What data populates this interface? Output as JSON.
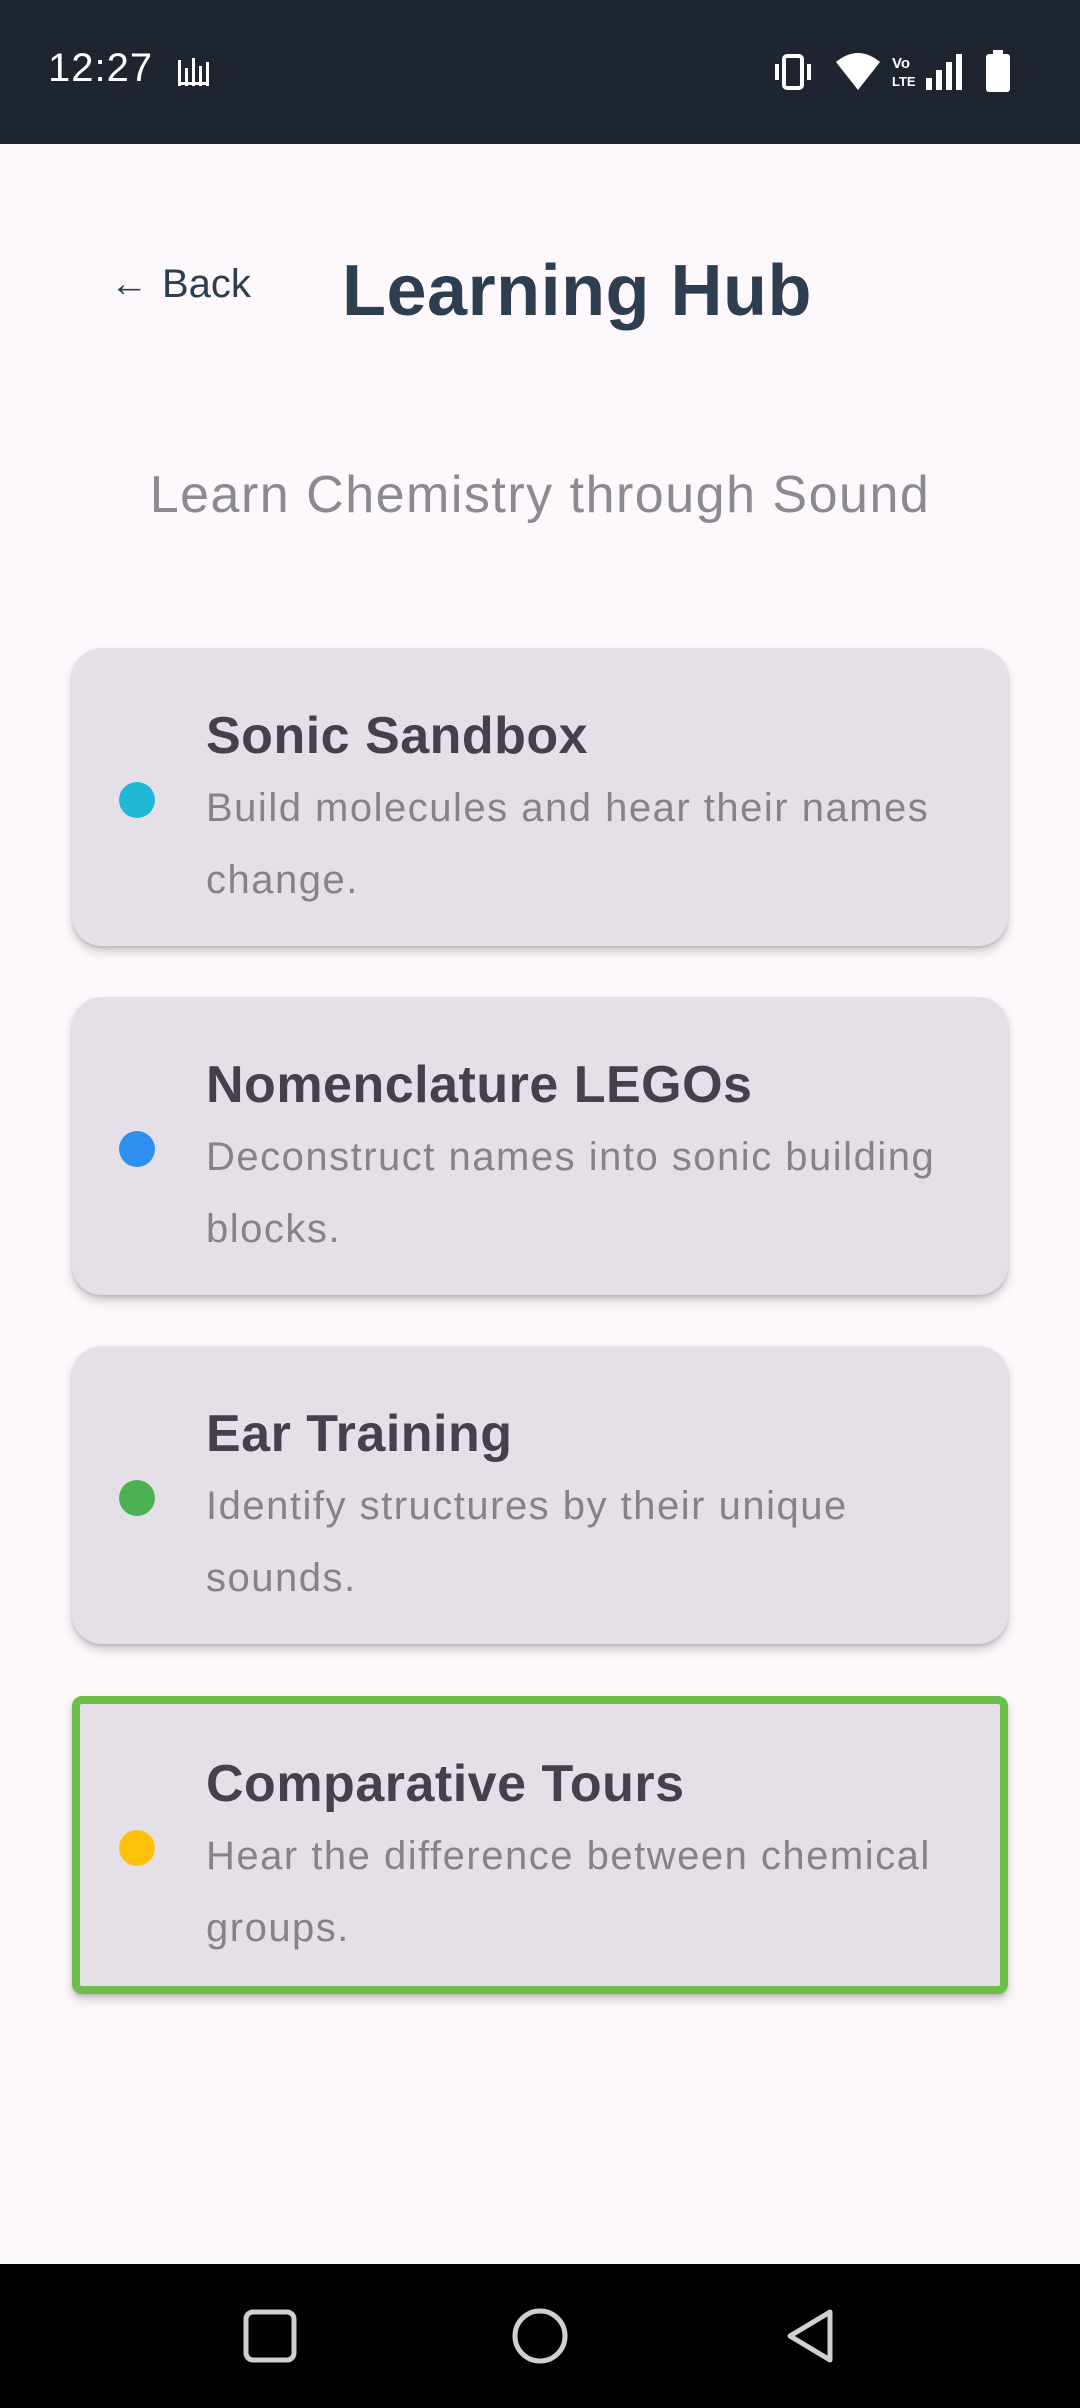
{
  "status_bar": {
    "time": "12:27",
    "left_icons": [
      "sound-bars-icon"
    ],
    "right_icons": [
      "vibrate-icon",
      "wifi-icon",
      "volte-icon",
      "signal-icon",
      "battery-icon"
    ]
  },
  "header": {
    "back_arrow": "←",
    "back_label": "Back",
    "title": "Learning Hub",
    "subtitle": "Learn Chemistry through Sound"
  },
  "modules": [
    {
      "title": "Sonic Sandbox",
      "description": "Build molecules and hear their names change.",
      "dot_color": "#1fb8d6",
      "selected": false
    },
    {
      "title": "Nomenclature LEGOs",
      "description": "Deconstruct names into sonic building blocks.",
      "dot_color": "#2f8ff0",
      "selected": false
    },
    {
      "title": "Ear Training",
      "description": "Identify structures by their unique sounds.",
      "dot_color": "#4caf50",
      "selected": false
    },
    {
      "title": "Comparative Tours",
      "description": "Hear the difference between chemical groups.",
      "dot_color": "#ffc107",
      "selected": true
    }
  ],
  "colors": {
    "status_bar_bg": "#1e2430",
    "background": "#fdf8fb",
    "card_bg": "#e5e0e7",
    "title_color": "#2c3e50",
    "selection_border": "#6cc04a"
  },
  "nav_bar": {
    "buttons": [
      "recents-square-icon",
      "home-circle-icon",
      "back-triangle-icon"
    ]
  }
}
